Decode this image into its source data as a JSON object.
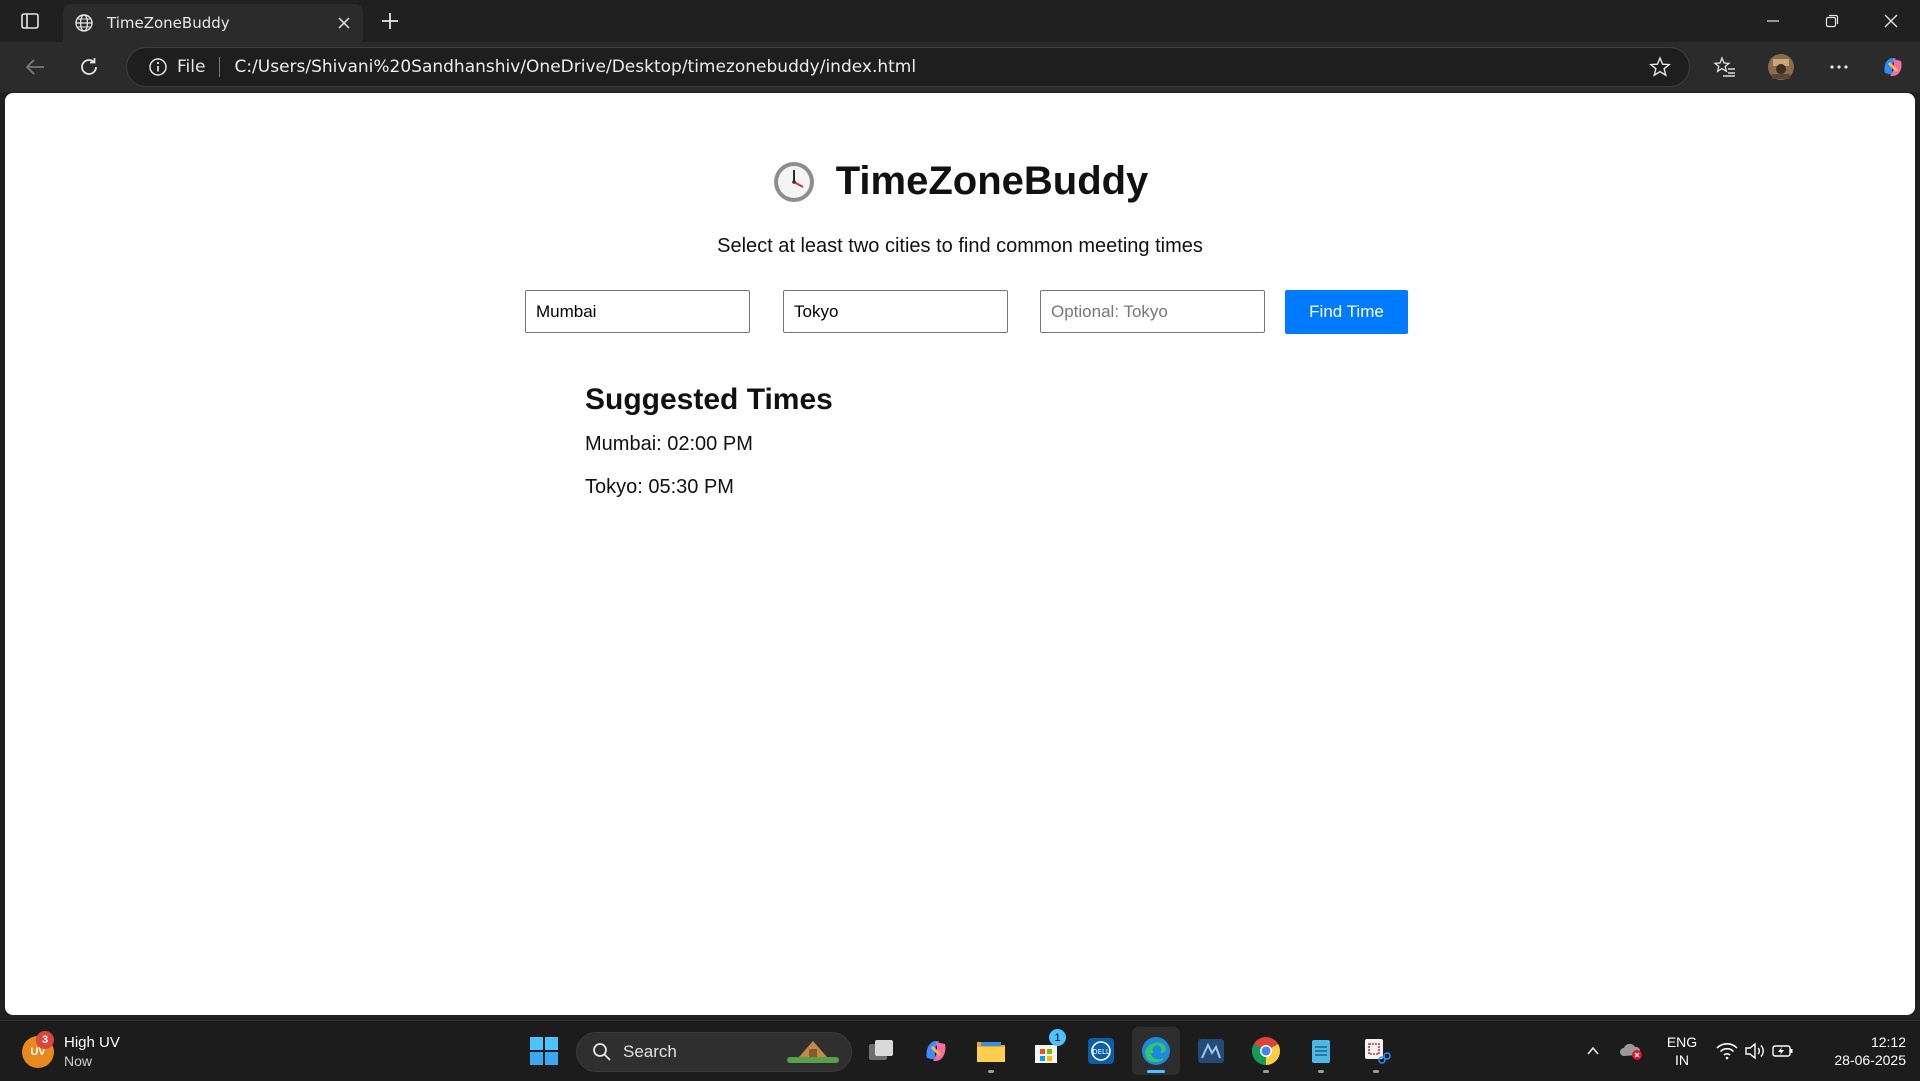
{
  "browser": {
    "tab_title": "TimeZoneBuddy",
    "address_scheme": "File",
    "address_url": "C:/Users/Shivani%20Sandhanshiv/OneDrive/Desktop/timezonebuddy/index.html"
  },
  "page": {
    "title": "TimeZoneBuddy",
    "clock_emoji": "clock-icon",
    "subtitle": "Select at least two cities to find common meeting times",
    "inputs": [
      {
        "value": "Mumbai",
        "placeholder": ""
      },
      {
        "value": "Tokyo",
        "placeholder": ""
      },
      {
        "value": "",
        "placeholder": "Optional: Tokyo"
      }
    ],
    "find_button": "Find Time",
    "results_heading": "Suggested Times",
    "results": [
      "Mumbai: 02:00 PM",
      "Tokyo: 05:30 PM"
    ]
  },
  "taskbar": {
    "weather_badge": "UV",
    "weather_count": "3",
    "weather_title": "High UV",
    "weather_sub": "Now",
    "search_label": "Search",
    "store_badge": "1",
    "lang_line1": "ENG",
    "lang_line2": "IN",
    "time": "12:12",
    "date": "28-06-2025"
  },
  "colors": {
    "accent_button": "#007bff",
    "taskbar_active": "#4cc2ff"
  }
}
